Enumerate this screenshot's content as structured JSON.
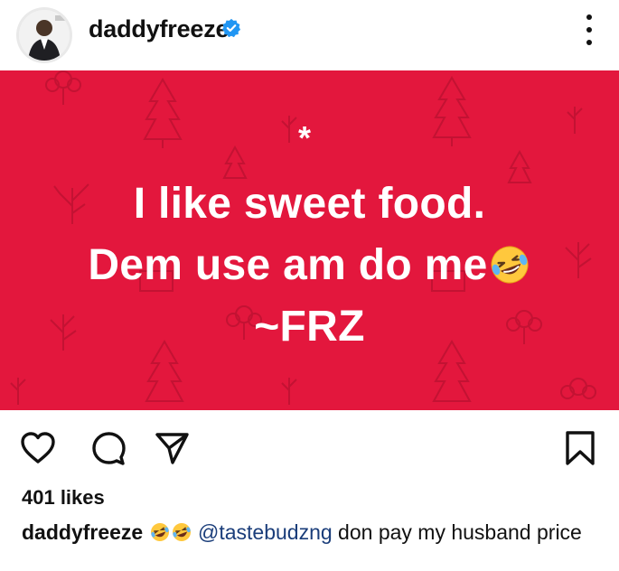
{
  "header": {
    "username": "daddyfreeze",
    "verified_icon": "verified-badge-icon",
    "more_icon": "more-vertical-icon"
  },
  "post": {
    "background_color": "#e3173d",
    "text_line1": "I like sweet food.",
    "text_line2": "Dem use am do me",
    "text_line3": "~FRZ",
    "asterisk": "*",
    "emoji": "rofl-emoji"
  },
  "actions": {
    "like_icon": "heart-icon",
    "comment_icon": "comment-icon",
    "share_icon": "send-icon",
    "save_icon": "bookmark-icon"
  },
  "likes_text": "401 likes",
  "caption": {
    "username": "daddyfreeze",
    "mention": "@tastebudzng",
    "text": " don pay my husband price"
  }
}
